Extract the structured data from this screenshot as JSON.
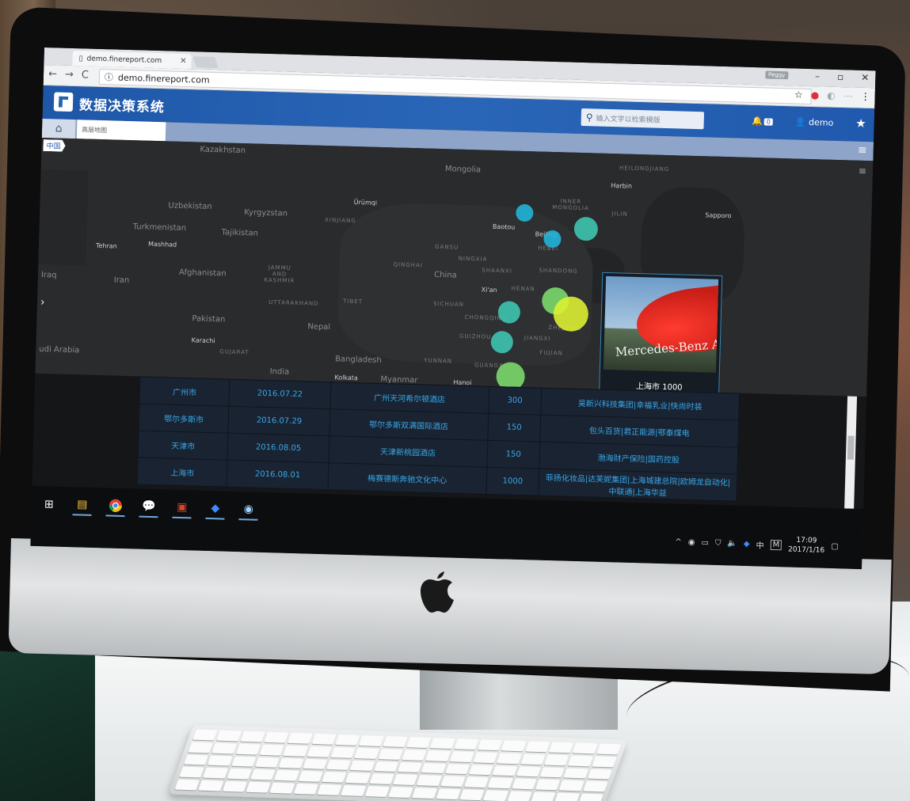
{
  "browser": {
    "tab_title": "demo.finereport.com",
    "url": "demo.finereport.com",
    "profile_badge": "Peggy"
  },
  "app": {
    "title": "数据决策系统",
    "search_placeholder": "输入文字以检索模版",
    "notification_count": "0",
    "user": "demo",
    "page_tab": "高层地图"
  },
  "map": {
    "badge": "中国",
    "labels": [
      "Kazakhstan",
      "Mongolia",
      "Uzbekistan",
      "Kyrgyzstan",
      "Turkmenistan",
      "Tajikistan",
      "Tehran",
      "Mashhad",
      "Afghanistan",
      "Iran",
      "Pakistan",
      "Nepal",
      "India",
      "Bangladesh",
      "Myanmar",
      "Karachi",
      "China",
      "Harbin",
      "Sapporo",
      "Beijing",
      "Baotou",
      "Xi'an",
      "Hanoi",
      "Kolkata",
      "Iraq",
      "udi Arabia",
      "Ürümqi"
    ],
    "region_labels": [
      "HEILONGJIANG",
      "INNER MONGOLIA",
      "JILIN",
      "XINJIANG",
      "GANSU",
      "NINGXIA",
      "QINGHAI",
      "SHAANXI",
      "SHANDONG",
      "HENAN",
      "TIBET",
      "SICHUAN",
      "CHONGQING",
      "GUIZHOU",
      "JIANGXI",
      "ZHEJIANG",
      "FUJIAN",
      "YUNNAN",
      "GUANGXI",
      "JAMMU AND KASHMIR",
      "UTTARAKHAND",
      "GUJARAT",
      "HEBEI"
    ],
    "popup_title": "Mercedes-Benz Arena",
    "popup_caption": "上海市 1000",
    "colors": {
      "teal": "#3fc4b0",
      "blue": "#22b5d8",
      "green": "#7bd96b",
      "yellow": "#dcf032"
    }
  },
  "table": {
    "rows": [
      {
        "city": "广州市",
        "date": "2016.07.22",
        "venue": "广州天河希尔顿酒店",
        "amount": "300",
        "sponsors": "吴新兴科技集团|幸福乳业|快尚时装"
      },
      {
        "city": "鄂尔多斯市",
        "date": "2016.07.29",
        "venue": "鄂尔多斯双满国际酒店",
        "amount": "150",
        "sponsors": "包头百货|君正能源|鄂泰煤电"
      },
      {
        "city": "天津市",
        "date": "2016.08.05",
        "venue": "天津新桃园酒店",
        "amount": "150",
        "sponsors": "渤海财产保险|国药控股"
      },
      {
        "city": "上海市",
        "date": "2016.08.01",
        "venue": "梅赛德斯奔驰文化中心",
        "amount": "1000",
        "sponsors": "菲扬化妆品|达芙妮集团|上海城建总院|欧姆龙自动化|中联通|上海华益"
      }
    ]
  },
  "taskbar": {
    "apps": [
      "windows-start",
      "file-explorer",
      "chrome",
      "wechat",
      "powerpoint",
      "app-blue",
      "app-circle"
    ],
    "ime": "中",
    "ime_mode": "M",
    "time": "17:09",
    "date": "2017/1/16"
  }
}
